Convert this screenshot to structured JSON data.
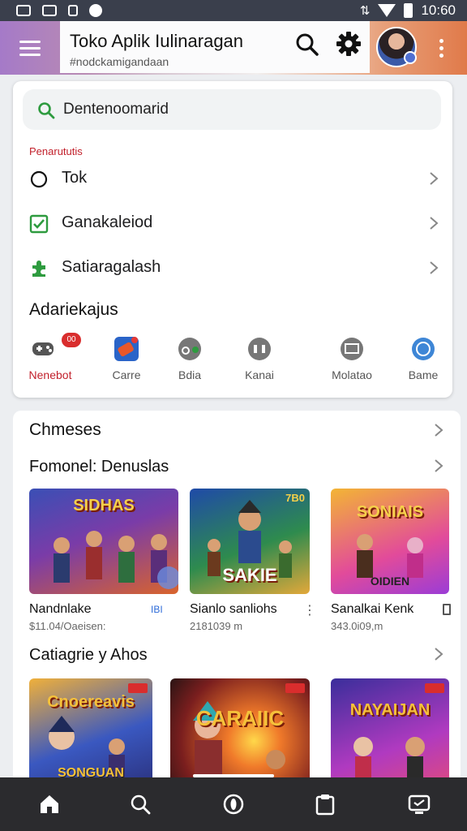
{
  "status_bar": {
    "time": "10:60"
  },
  "app_bar": {
    "title": "Toko Aplik Iulinaragan",
    "subtitle": "#nodckamigandaan"
  },
  "search": {
    "query": "Dentenoomarid"
  },
  "menu_section": {
    "label": "Penarututis",
    "items": [
      {
        "label": "Tok",
        "icon": "circle-icon"
      },
      {
        "label": "Ganakaleiod",
        "icon": "checkbox-icon"
      },
      {
        "label": "Satiaragalash",
        "icon": "puzzle-icon"
      }
    ]
  },
  "categories": {
    "title": "Adariekajus",
    "items": [
      {
        "label": "Nenebot",
        "icon": "gamepad-icon",
        "badge": "00",
        "active": true
      },
      {
        "label": "Carre",
        "icon": "car-icon",
        "active": false
      },
      {
        "label": "Bdia",
        "icon": "bike-icon",
        "active": false
      },
      {
        "label": "Kanai",
        "icon": "people-icon",
        "active": false
      },
      {
        "label": "Molatao",
        "icon": "tv-icon",
        "active": false
      },
      {
        "label": "Bame",
        "icon": "globe-icon",
        "active": false
      }
    ]
  },
  "chmeses": {
    "title": "Chmeses"
  },
  "featured": {
    "title": "Fomonel: Denuslas",
    "games": [
      {
        "art_title": "SIDHAS",
        "name": "Nandnlake",
        "meta": "$11.04/Oaeisen:",
        "badge": "IBI",
        "corner_badge": ""
      },
      {
        "art_title": "",
        "art_subtitle": "SAKIE",
        "name": "Sianlo sanliohs",
        "meta": "2181039 m",
        "corner_badge": "7B0"
      },
      {
        "art_title": "SONIAIS",
        "art_subtitle": "OIDIEN",
        "name": "Sanalkai Kenk",
        "meta": "343.0i09,m"
      }
    ]
  },
  "categories_section": {
    "title": "Catiagrie y Ahos",
    "games": [
      {
        "art_title": "Cnoereavis",
        "art_subtitle": "SONGUAN"
      },
      {
        "art_title": "CARAIIC"
      },
      {
        "art_title": "NAYAIJAN"
      }
    ]
  },
  "bottom_nav": {
    "items": [
      {
        "icon": "home-icon"
      },
      {
        "icon": "search-icon"
      },
      {
        "icon": "compass-icon"
      },
      {
        "icon": "clipboard-icon"
      },
      {
        "icon": "device-icon"
      }
    ]
  },
  "colors": {
    "accent_red": "#c2212c",
    "accent_green": "#2e9b3f",
    "nav_bg": "#2b2b2e"
  }
}
